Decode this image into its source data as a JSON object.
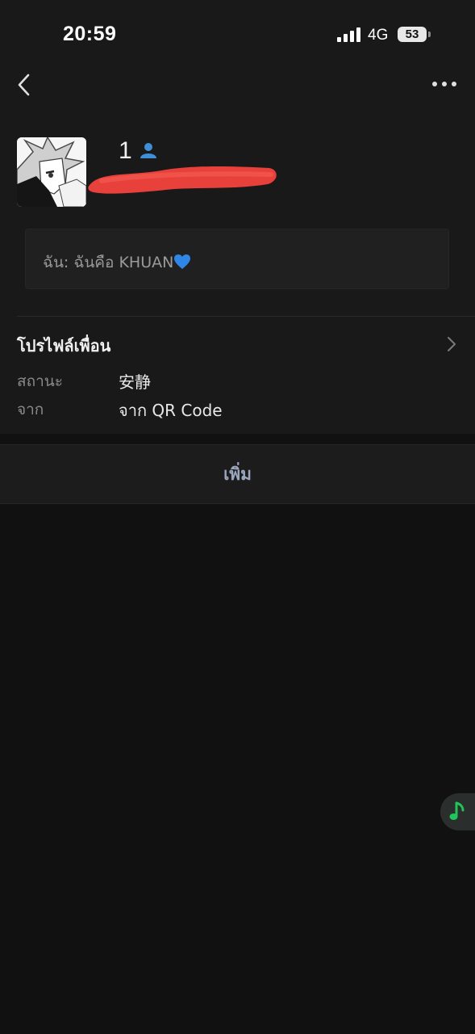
{
  "status_bar": {
    "time": "20:59",
    "network": "4G",
    "battery": "53"
  },
  "nav": {
    "back_icon": "chevron-left-icon",
    "more_icon": "more-horizontal-icon"
  },
  "profile": {
    "name": "1",
    "friend_badge_icon": "friend-person-icon",
    "moment_text": "ฉัน: ฉันคือ KHUAN",
    "moment_emoji_icon": "blue-heart-icon"
  },
  "friend_profile": {
    "title": "โปรไฟล์เพื่อน",
    "status_label": "สถานะ",
    "status_value": "安静",
    "source_label": "จาก",
    "source_value": "จาก QR Code"
  },
  "actions": {
    "add_label": "เพิ่ม"
  },
  "floating": {
    "music_icon": "music-note-icon"
  },
  "colors": {
    "background": "#111111",
    "panel": "#191919",
    "accent_green": "#1fc45a",
    "friend_badge_blue": "#3f8fd8",
    "redaction_red": "#e8403a"
  }
}
